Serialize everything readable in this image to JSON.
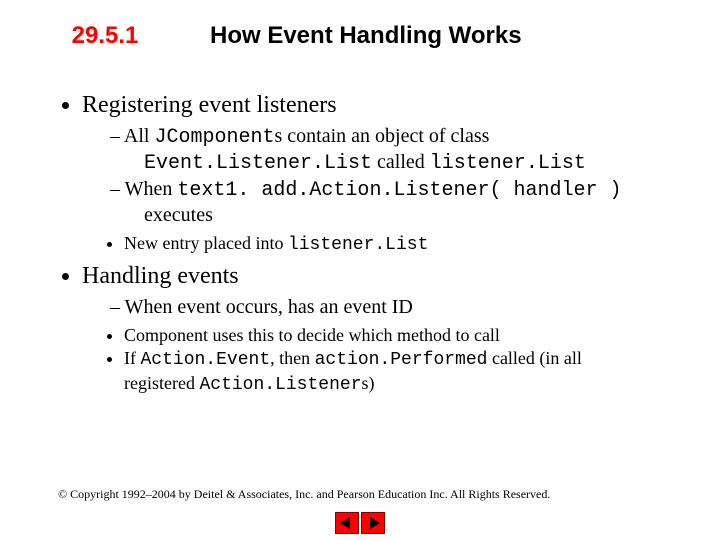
{
  "header": {
    "section_number": "29.5.1",
    "title": "How Event Handling Works"
  },
  "bullets": {
    "b1": "Registering event listeners",
    "b1_d1_pre": "All ",
    "b1_d1_code1": "JComponent",
    "b1_d1_mid": "s contain an object of class",
    "b1_d1_line2_code1": "Event.Listener.List",
    "b1_d1_line2_mid": " called ",
    "b1_d1_line2_code2": "listener.List",
    "b1_d2_pre": "When ",
    "b1_d2_code": "text1. add.Action.Listener( handler )",
    "b1_d2_line2": "executes",
    "b1_s1_pre": "New entry placed into ",
    "b1_s1_code": "listener.List",
    "b2": "Handling events",
    "b2_d1": "When event occurs, has an event ID",
    "b2_s1": "Component uses this to decide which method to call",
    "b2_s2_pre": "If ",
    "b2_s2_code1": "Action.Event",
    "b2_s2_mid": ", then ",
    "b2_s2_code2": "action.Performed",
    "b2_s2_post": " called (in all",
    "b2_s2_line2_pre": "registered ",
    "b2_s2_line2_code": "Action.Listener",
    "b2_s2_line2_post": "s)"
  },
  "copyright": "© Copyright 1992–2004 by Deitel & Associates, Inc. and Pearson Education Inc. All Rights Reserved."
}
